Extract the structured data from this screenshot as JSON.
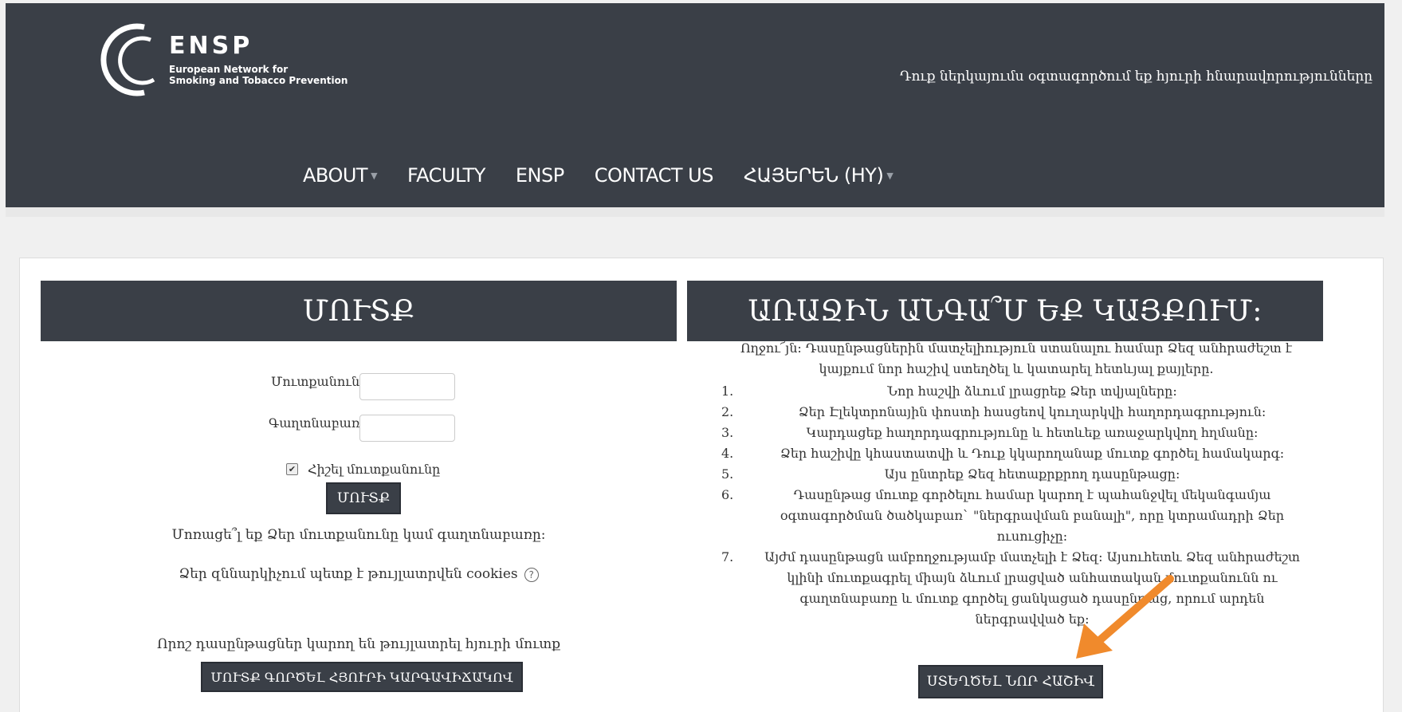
{
  "header": {
    "logo_title": "ENSP",
    "logo_sub_line1": "European Network for",
    "logo_sub_line2": "Smoking and Tobacco Prevention",
    "guest_notice": "Դուք ներկայումս օգտագործում եք հյուրի հնարավորությունները",
    "nav": {
      "about": "ABOUT",
      "faculty": "FACULTY",
      "ensp": "ENSP",
      "contact": "CONTACT US",
      "language": "ՀԱՅԵՐԵՆ (HY)"
    }
  },
  "login": {
    "title": "ՄՈՒՏՔ",
    "username_label": "Մուտքանուն",
    "password_label": "Գաղտնաբառ",
    "remember_label": "Հիշել մուտքանունը",
    "remember_checked": true,
    "login_button": "ՄՈՒՏՔ",
    "forgot_text": "Մոռացե՞լ եք Ձեր մուտքանունը կամ գաղտնաբառը:",
    "cookies_text": "Ձեր զննարկիչում պետք է թույլատրվեն cookies",
    "guest_text": "Որոշ դասընթացներ կարող են թույլատրել հյուրի մուտք",
    "guest_button": "ՄՈՒՏՔ ԳՈՐԾԵԼ ՀՅՈՒՐԻ ԿԱՐԳԱՎԻՃԱԿՈՎ"
  },
  "signup": {
    "title": "ԱՌԱՋԻՆ ԱՆԳԱ՞Մ ԵՔ ԿԱՅՔՈՒՄ:",
    "intro_line1": "Ողջու՜յն: Դասընթացներին մատչելիություն ստանալու համար Ձեզ անհրաժեշտ է",
    "intro_line2": "կայքում նոր հաշիվ ստեղծել և կատարել հետևյալ քայլերը.",
    "steps": [
      {
        "num": "1.",
        "text": "Նոր հաշվի ձևում լրացրեք Ձեր տվյալները:"
      },
      {
        "num": "2.",
        "text": "Ձեր Էլեկտրոնային փոստի հասցեով կուղարկվի հաղորդագրություն:"
      },
      {
        "num": "3.",
        "text": "Կարդացեք հաղորդագրությունը և հետևեք առաջարկվող հղմանը:"
      },
      {
        "num": "4.",
        "text": "Ձեր հաշիվը կհաստատվի և Դուք կկարողանաք մուտք գործել համակարգ:"
      },
      {
        "num": "5.",
        "text": "Այս ընտրեք Ձեզ հետաքրքրող դասընթացը:"
      },
      {
        "num": "6.",
        "text": "Դասընթաց մուտք գործելու համար կարող է պահանջվել մեկանգամյա օգտագործման ծածկաբառ` \"ներգրավման բանալի\", որը կտրամադրի Ձեր ուսուցիչը:"
      },
      {
        "num": "7.",
        "text": "Այժմ դասընթացն ամբողջությամբ մատչելի է Ձեզ: Այսուհետև Ձեզ անհրաժեշտ կլինի մուտքագրել միայն ձևում լրացված անհատական մուտքանունն ու գաղտնաբառը և մուտք գործել ցանկացած դասընթաց, որում արդեն ներգրավված եք:"
      }
    ],
    "create_button": "ՍՏԵՂԾԵԼ ՆՈՐ ՀԱՇԻՎ"
  },
  "colors": {
    "header_bg": "#3a3f47",
    "arrow": "#f08a2c"
  }
}
